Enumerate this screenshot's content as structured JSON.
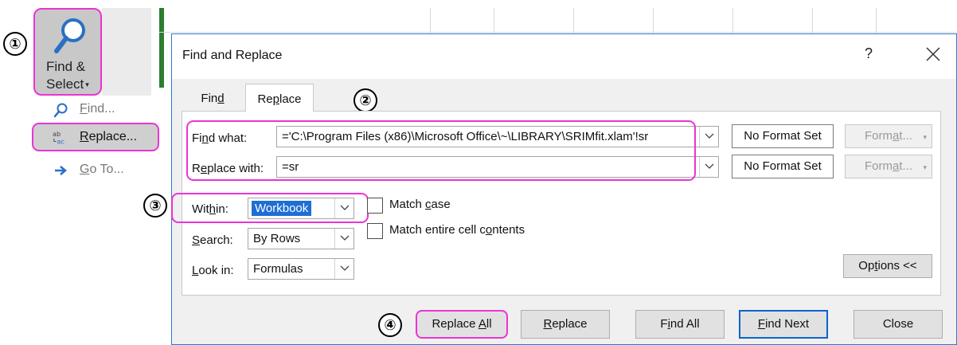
{
  "ribbon": {
    "find_select_line1": "Find &",
    "find_select_line2": "Select",
    "caret": "▾",
    "icon": "magnifier-icon"
  },
  "menu": {
    "items": [
      {
        "label": "Find...",
        "icon": "search-icon",
        "hotkey_index": 0
      },
      {
        "label": "Replace...",
        "icon": "replace-abc-icon",
        "hotkey_index": 0
      },
      {
        "label": "Go To...",
        "icon": "arrow-right-icon",
        "hotkey_index": 0
      }
    ]
  },
  "callouts": [
    "①",
    "②",
    "③",
    "④"
  ],
  "dialog": {
    "title": "Find and Replace",
    "help": "?",
    "tabs": [
      {
        "label_a": "Fin",
        "label_u": "d",
        "label_b": ""
      },
      {
        "label_a": "Re",
        "label_u": "p",
        "label_b": "lace"
      }
    ],
    "find_what": {
      "label_a": "Fi",
      "label_u": "n",
      "label_b": "d what:",
      "value": "='C:\\Program Files (x86)\\Microsoft Office\\~\\LIBRARY\\SRIMfit.xlam'!sr",
      "format_status": "No Format Set",
      "format_btn_a": "Form",
      "format_btn_u": "a",
      "format_btn_b": "t...",
      "format_caret": "▾"
    },
    "replace_with": {
      "label_a": "R",
      "label_u": "e",
      "label_b": "place with:",
      "value": "=sr",
      "format_status": "No Format Set",
      "format_btn_a": "Form",
      "format_btn_u": "a",
      "format_btn_b": "t...",
      "format_caret": "▾"
    },
    "within": {
      "label_a": "Wit",
      "label_u": "h",
      "label_b": "in:",
      "value": "Workbook"
    },
    "search": {
      "label_a": "",
      "label_u": "S",
      "label_b": "earch:",
      "value": "By Rows"
    },
    "look_in": {
      "label_a": "",
      "label_u": "L",
      "label_b": "ook in:",
      "value": "Formulas"
    },
    "match_case": {
      "label_a": "Match ",
      "label_u": "c",
      "label_b": "ase",
      "checked": false
    },
    "match_entire": {
      "label_a": "Match entire cell c",
      "label_u": "o",
      "label_b": "ntents",
      "checked": false
    },
    "options_btn": {
      "label_a": "Op",
      "label_u": "t",
      "label_b": "ions <<"
    },
    "buttons": {
      "replace_all": {
        "a": "Replace ",
        "u": "A",
        "b": "ll"
      },
      "replace": {
        "a": "",
        "u": "R",
        "b": "eplace"
      },
      "find_all": {
        "a": "F",
        "u": "i",
        "b": "nd All"
      },
      "find_next": {
        "a": "",
        "u": "F",
        "b": "ind Next"
      },
      "close": {
        "a": "Close",
        "u": "",
        "b": ""
      }
    }
  },
  "colors": {
    "highlight": "#ea34d4",
    "selection": "#1e6ed6",
    "default_button_border": "#0b63ce",
    "dialog_border": "#2b79d6"
  }
}
